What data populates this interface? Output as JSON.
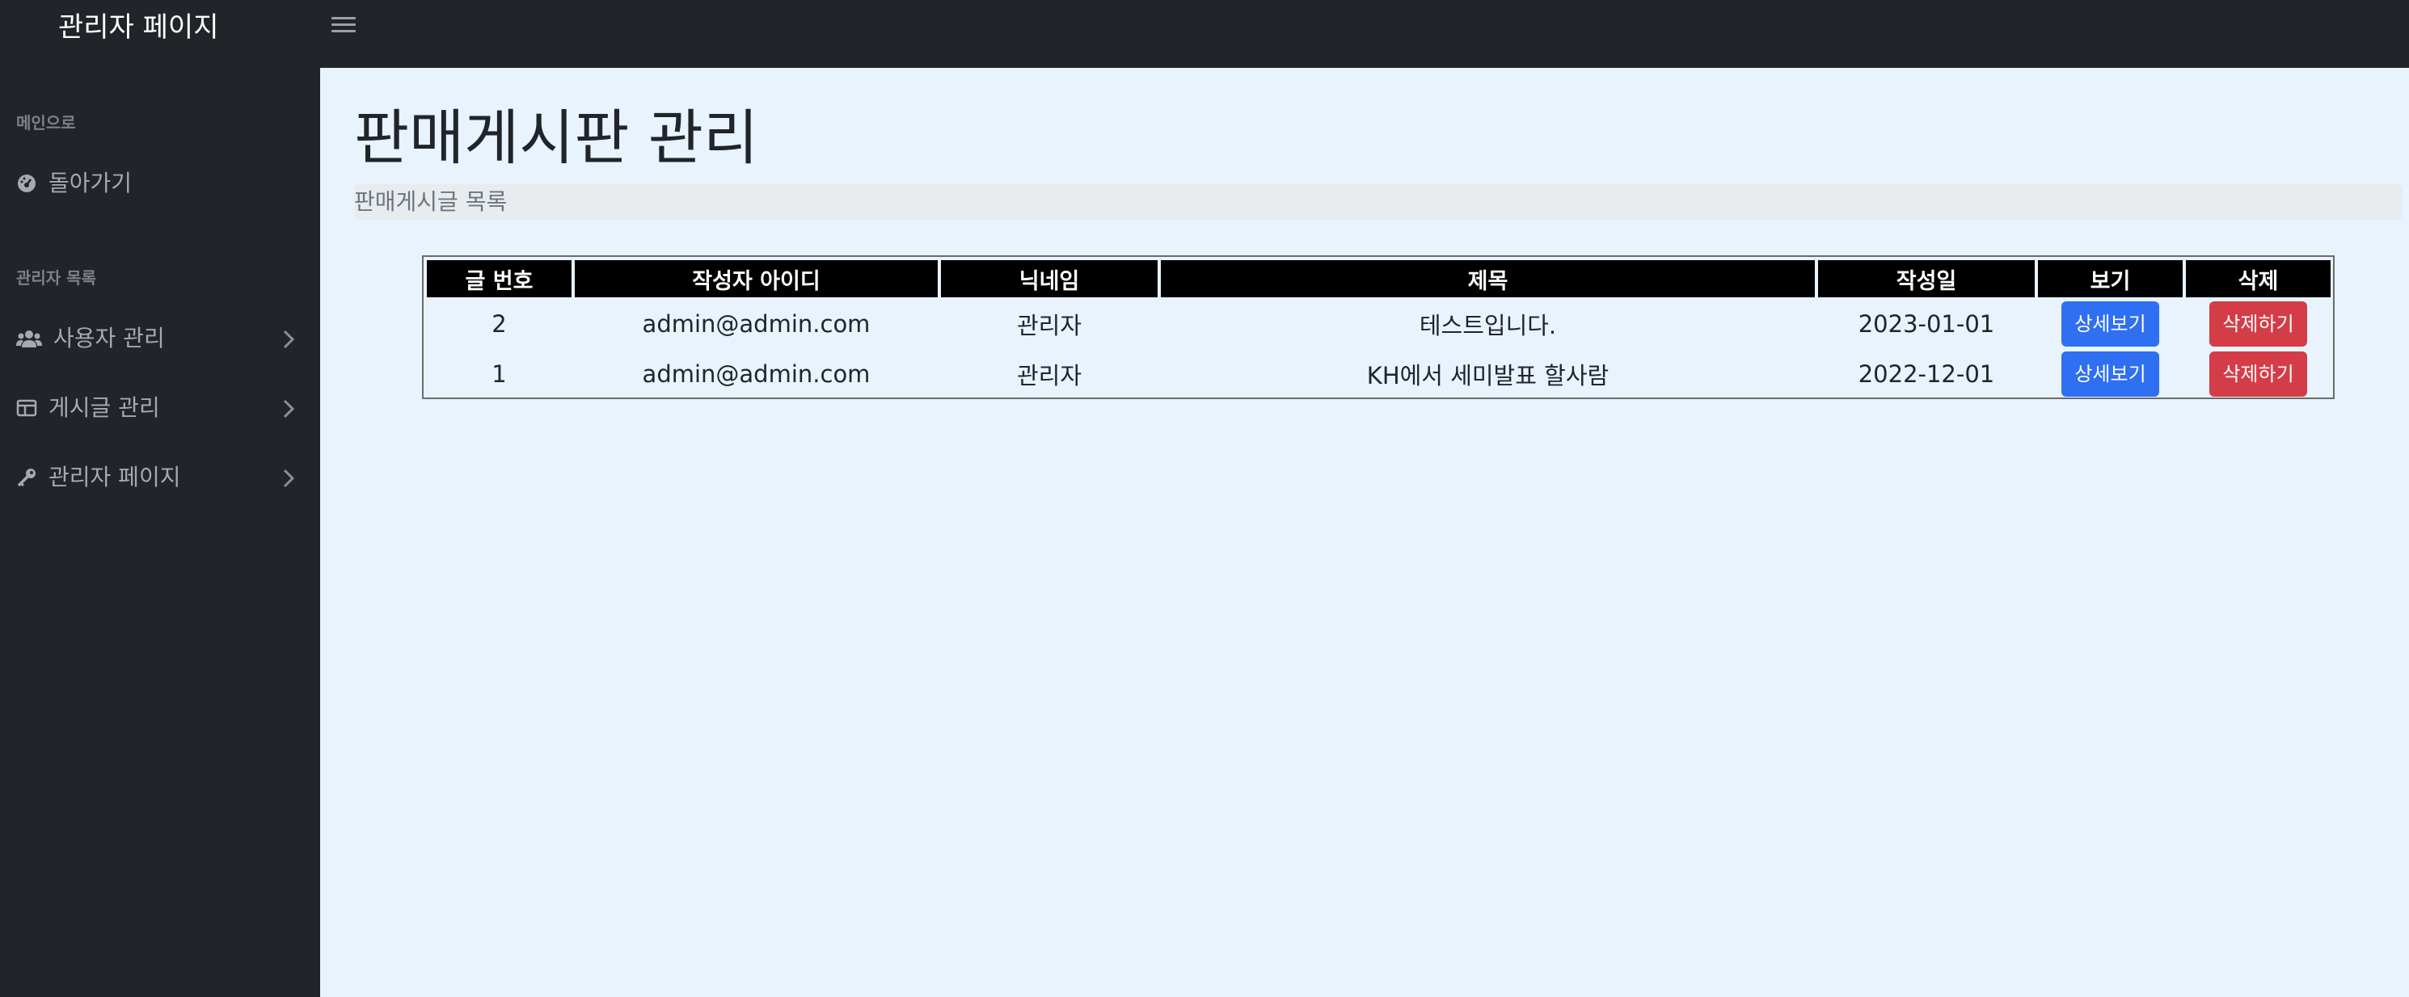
{
  "app": {
    "brand": "관리자 페이지",
    "toggle_icon": "hamburger-menu-icon"
  },
  "sidebar": {
    "sections": [
      {
        "heading": "메인으로",
        "items": [
          {
            "label": "돌아가기",
            "icon": "dashboard-gauge-icon",
            "has_chevron": false
          }
        ]
      },
      {
        "heading": "관리자 목록",
        "items": [
          {
            "label": "사용자 관리",
            "icon": "users-icon",
            "has_chevron": true
          },
          {
            "label": "게시글 관리",
            "icon": "columns-icon",
            "has_chevron": true
          },
          {
            "label": "관리자 페이지",
            "icon": "key-icon",
            "has_chevron": true
          }
        ]
      }
    ]
  },
  "main": {
    "title": "판매게시판 관리",
    "breadcrumb": "판매게시글 목록"
  },
  "table": {
    "headers": [
      "글 번호",
      "작성자 아이디",
      "닉네임",
      "제목",
      "작성일",
      "보기",
      "삭제"
    ],
    "rows": [
      {
        "no": "2",
        "author_id": "admin@admin.com",
        "nickname": "관리자",
        "title": "테스트입니다.",
        "date": "2023-01-01",
        "view_label": "상세보기",
        "delete_label": "삭제하기"
      },
      {
        "no": "1",
        "author_id": "admin@admin.com",
        "nickname": "관리자",
        "title": "KH에서 세미발표 할사람",
        "date": "2022-12-01",
        "view_label": "상세보기",
        "delete_label": "삭제하기"
      }
    ]
  },
  "colors": {
    "topbar": "#212529",
    "sidebar": "#212529",
    "content_bg": "#e8f3fe",
    "primary": "#2f6ff1",
    "danger": "#d43d48",
    "table_header": "#000000"
  }
}
